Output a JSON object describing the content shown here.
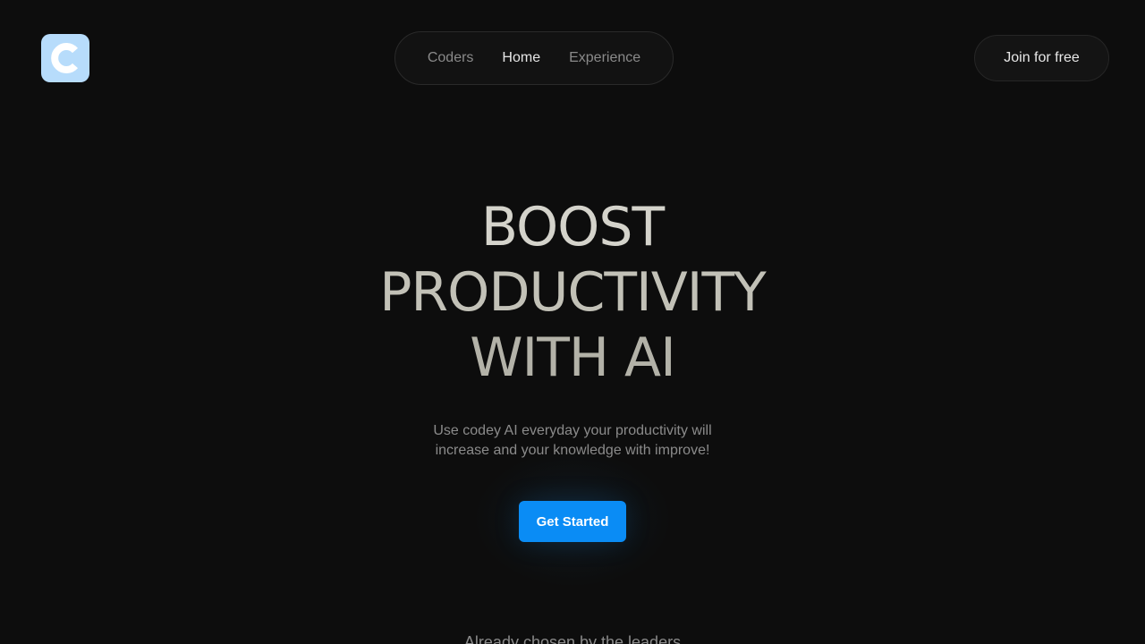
{
  "brand": {
    "logo_icon": "letter-c-logo-icon",
    "logo_color": "#b7dcfb"
  },
  "nav": {
    "items": [
      {
        "label": "Coders"
      },
      {
        "label": "Home"
      },
      {
        "label": "Experience"
      }
    ],
    "active": "Home"
  },
  "header": {
    "join_label": "Join for free"
  },
  "hero": {
    "title_lines": [
      "BOOST",
      "PRODUCTIVITY",
      "WITH AI"
    ],
    "subtitle_line1": "Use codey AI everyday your productivity will",
    "subtitle_line2": "increase and your knowledge with improve!",
    "cta_label": "Get Started",
    "cta_color": "#0a8cf5"
  },
  "leaders": {
    "text": "Already chosen by the leaders"
  }
}
